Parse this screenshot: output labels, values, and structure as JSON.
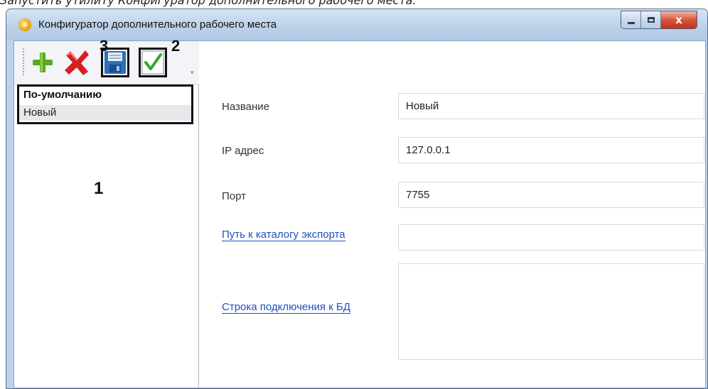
{
  "document": {
    "prefix": "Запустить утилиту ",
    "emph": "Конфигуратор дополнительного рабочего места",
    "suffix": "."
  },
  "window": {
    "title": "Конфигуратор дополнительного рабочего места",
    "icon": "app-gear-icon",
    "controls": {
      "minimize": "minimize-icon",
      "maximize": "maximize-icon",
      "close_label": "x"
    }
  },
  "toolbar": {
    "buttons": [
      {
        "name": "add",
        "icon": "plus-icon",
        "color": "#5aa81e"
      },
      {
        "name": "delete",
        "icon": "red-cross-icon",
        "color": "#d71f1f"
      },
      {
        "name": "save",
        "icon": "floppy-disk-icon",
        "color": "#2f6fb8"
      },
      {
        "name": "apply",
        "icon": "checkmark-icon",
        "color": "#38a62a"
      }
    ]
  },
  "callouts": {
    "one": "1",
    "two": "2",
    "three": "3"
  },
  "list": {
    "items": [
      {
        "label": "По-умолчанию",
        "bold": true
      },
      {
        "label": "Новый",
        "selected": true
      }
    ]
  },
  "form": {
    "name_label": "Название",
    "name_value": "Новый",
    "ip_label": "IP адрес",
    "ip_value": "127.0.0.1",
    "port_label": "Порт",
    "port_value": "7755",
    "export_path_label": "Путь к каталогу экспорта",
    "export_path_value": "",
    "db_conn_label": "Строка подключения к БД",
    "db_conn_value": ""
  },
  "colors": {
    "link": "#1f4fbf",
    "window_frame": "#bcd2ea",
    "close_button": "#d8553b"
  }
}
